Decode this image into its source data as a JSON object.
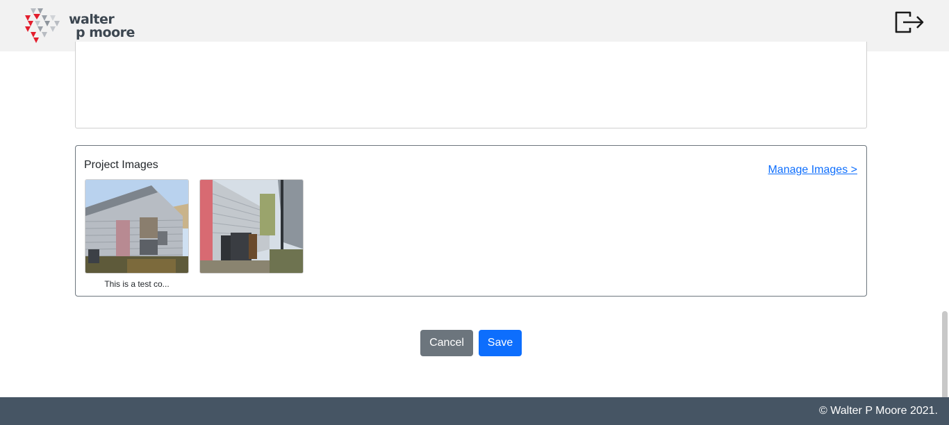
{
  "header": {
    "logo_line1": "walter",
    "logo_line2": "p moore",
    "logout_icon": "logout-icon"
  },
  "project_images": {
    "title": "Project Images",
    "manage_link": "Manage Images >",
    "images": [
      {
        "caption": "This is a test co..."
      },
      {
        "caption": ""
      }
    ]
  },
  "actions": {
    "cancel_label": "Cancel",
    "save_label": "Save"
  },
  "footer": {
    "copyright": "© Walter P Moore 2021."
  },
  "colors": {
    "header_bg": "#f2f2f2",
    "footer_bg": "#465564",
    "primary": "#0d6efd",
    "secondary": "#6c757d",
    "brand_red": "#e31e2d"
  }
}
